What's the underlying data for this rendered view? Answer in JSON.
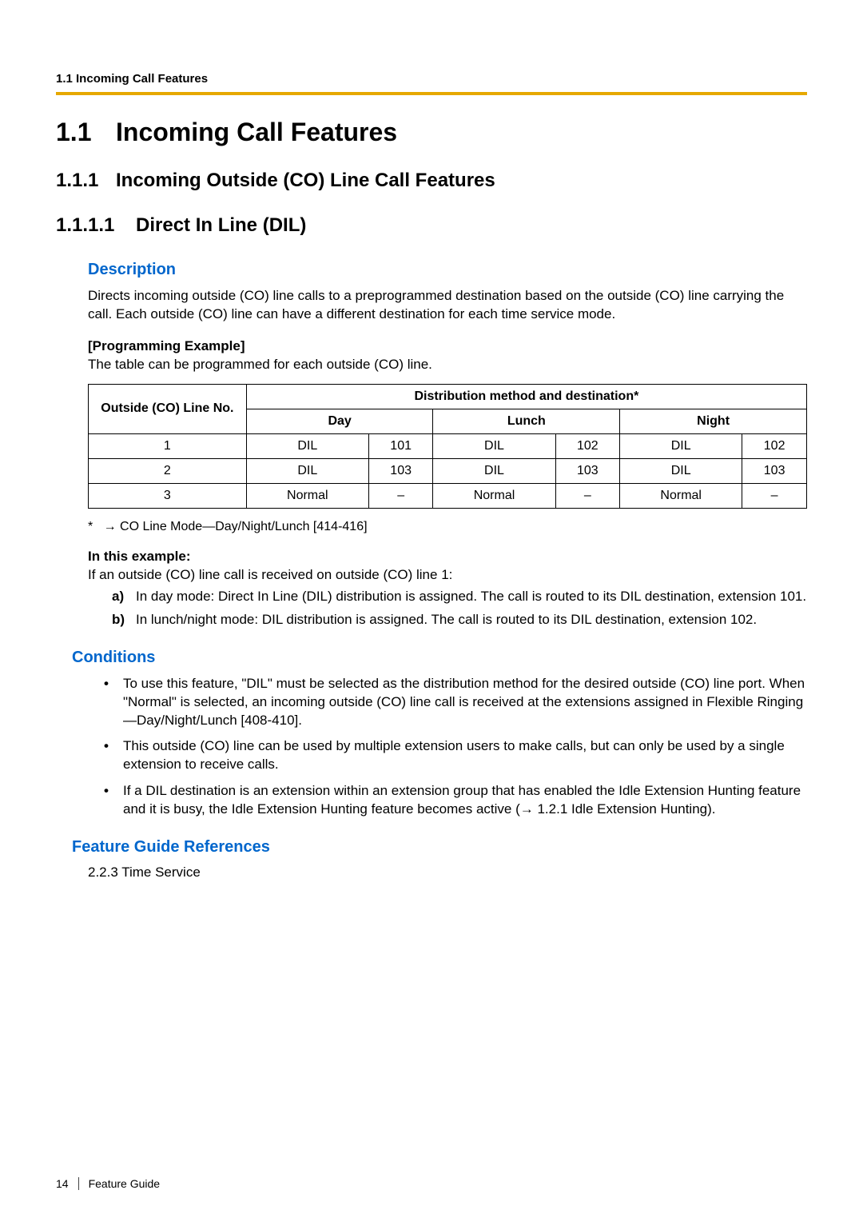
{
  "header": {
    "running": "1.1 Incoming Call Features"
  },
  "h1": {
    "num": "1.1",
    "title": "Incoming Call Features"
  },
  "h2": {
    "num": "1.1.1",
    "title": "Incoming Outside (CO) Line Call Features"
  },
  "h3": {
    "num": "1.1.1.1",
    "title": "Direct In Line (DIL)"
  },
  "description": {
    "heading": "Description",
    "para": "Directs incoming outside (CO) line calls to a preprogrammed destination based on the outside (CO) line carrying the call. Each outside (CO) line can have a different destination for each time service mode.",
    "prog_label": "[Programming Example]",
    "prog_text": "The table can be programmed for each outside (CO) line."
  },
  "table": {
    "col_line": "Outside (CO) Line No.",
    "col_dist": "Distribution method and destination*",
    "col_day": "Day",
    "col_lunch": "Lunch",
    "col_night": "Night",
    "rows": [
      {
        "no": "1",
        "day_m": "DIL",
        "day_d": "101",
        "lunch_m": "DIL",
        "lunch_d": "102",
        "night_m": "DIL",
        "night_d": "102"
      },
      {
        "no": "2",
        "day_m": "DIL",
        "day_d": "103",
        "lunch_m": "DIL",
        "lunch_d": "103",
        "night_m": "DIL",
        "night_d": "103"
      },
      {
        "no": "3",
        "day_m": "Normal",
        "day_d": "–",
        "lunch_m": "Normal",
        "lunch_d": "–",
        "night_m": "Normal",
        "night_d": "–"
      }
    ]
  },
  "footnote": {
    "star": "*",
    "arrow": "→",
    "text": "CO Line Mode—Day/Night/Lunch [414-416]"
  },
  "example": {
    "heading": "In this example:",
    "intro": "If an outside (CO) line call is received on outside (CO) line 1:",
    "a_marker": "a)",
    "a_text": "In day mode: Direct In Line (DIL) distribution is assigned. The call is routed to its DIL destination, extension 101.",
    "b_marker": "b)",
    "b_text": "In lunch/night mode: DIL distribution is assigned. The call is routed to its DIL destination, extension 102."
  },
  "conditions": {
    "heading": "Conditions",
    "b1": "To use this feature, \"DIL\" must be selected as the distribution method for the desired outside (CO) line port. When \"Normal\" is selected, an incoming outside (CO) line call is received at the extensions assigned in Flexible Ringing—Day/Night/Lunch [408-410].",
    "b2": "This outside (CO) line can be used by multiple extension users to make calls, but can only be used by a single extension to receive calls.",
    "b3_pre": "If a DIL destination is an extension within an extension group that has enabled the Idle Extension Hunting feature and it is busy, the Idle Extension Hunting feature becomes active (",
    "b3_arrow": "→",
    "b3_post": " 1.2.1 Idle Extension Hunting)."
  },
  "references": {
    "heading": "Feature Guide References",
    "item": "2.2.3 Time Service"
  },
  "footer": {
    "page": "14",
    "label": "Feature Guide"
  }
}
